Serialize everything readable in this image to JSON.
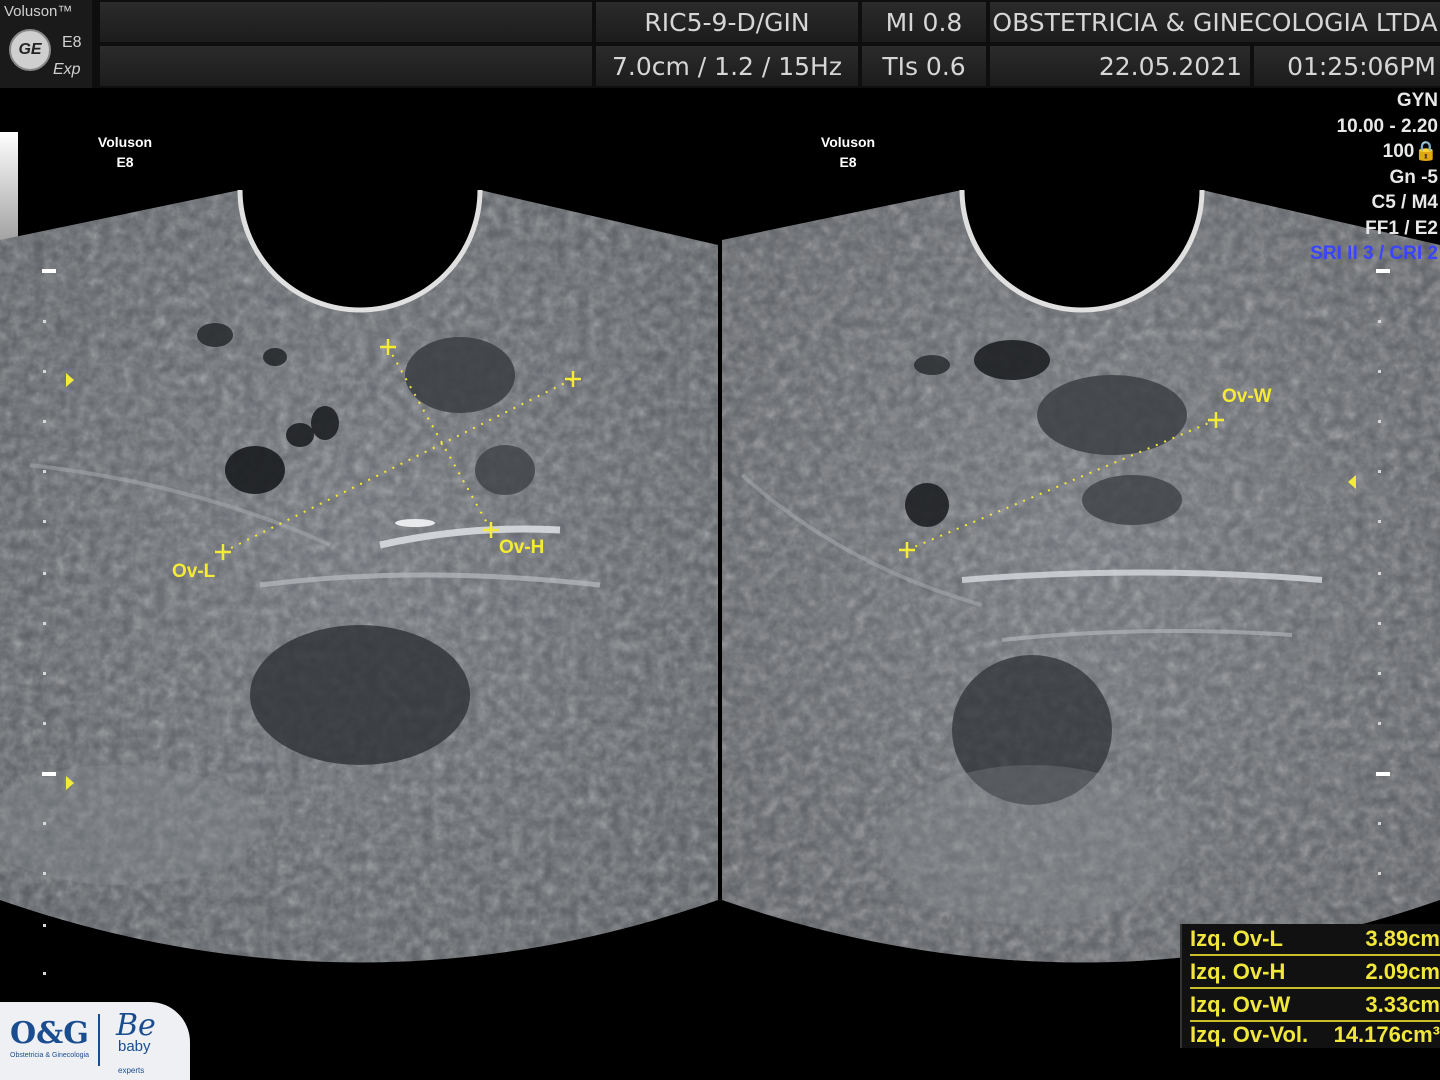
{
  "header": {
    "brand_name": "Voluson™",
    "brand_model": "E8",
    "brand_variant": "Exp",
    "brand_logo_text": "GE",
    "probe": "RIC5-9-D/GIN",
    "mi": "MI  0.8",
    "institution": "OBSTETRICIA & GINECOLOGIA LTDA",
    "depth_settings": "7.0cm / 1.2 / 15Hz",
    "tis": "TIs  0.6",
    "date": "22.05.2021",
    "time": "01:25:06PM"
  },
  "image_labels": {
    "left_brand": "Voluson",
    "left_model": "E8",
    "right_brand": "Voluson",
    "right_model": "E8"
  },
  "settings": {
    "preset": "GYN",
    "freq": "10.00 - 2.20",
    "power": "100🔒",
    "gain": "Gn  -5",
    "cm": "C5 / M4",
    "ff": "FF1 / E2",
    "sri": "SRI II 3 / CRI 2"
  },
  "markers": {
    "ov_l": "Ov-L",
    "ov_h": "Ov-H",
    "ov_w": "Ov-W"
  },
  "measurements": [
    {
      "label": "Izq. Ov-L",
      "value": "3.89cm"
    },
    {
      "label": "Izq. Ov-H",
      "value": "2.09cm"
    },
    {
      "label": "Izq. Ov-W",
      "value": "3.33cm"
    },
    {
      "label": "Izq. Ov-Vol.",
      "value": "14.176cm³"
    }
  ],
  "logo": {
    "og": "O&G",
    "og_sub": "Obstetricia & Ginecologia",
    "be": "Be",
    "baby": "baby",
    "experts": "experts"
  },
  "colors": {
    "marker_yellow": "#f5ea35",
    "sri_blue": "#3a44ff"
  }
}
